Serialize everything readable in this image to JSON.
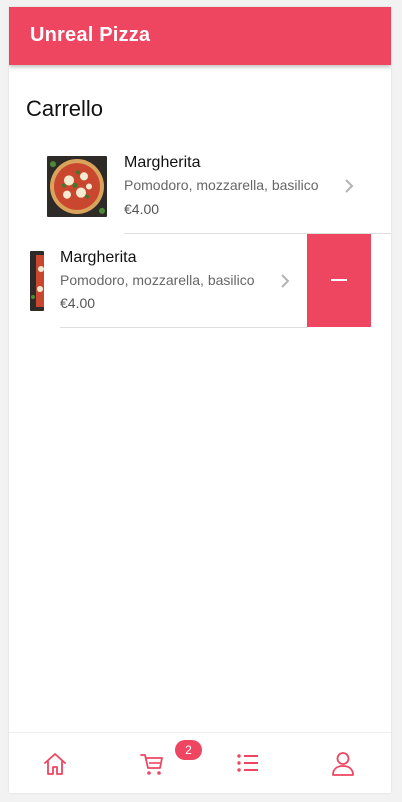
{
  "app": {
    "title": "Unreal Pizza"
  },
  "page": {
    "title": "Carrello"
  },
  "cart": {
    "items": [
      {
        "name": "Margherita",
        "description": "Pomodoro, mozzarella, basilico",
        "price": "€4.00",
        "image": "pizza-image"
      },
      {
        "name": "Margherita",
        "description": "Pomodoro, mozzarella, basilico",
        "price": "€4.00",
        "image": "pizza-image",
        "swipe_action": "remove"
      }
    ]
  },
  "tabbar": {
    "tabs": [
      {
        "name": "home",
        "icon": "home-icon"
      },
      {
        "name": "cart",
        "icon": "cart-icon",
        "badge": "2"
      },
      {
        "name": "list",
        "icon": "list-icon"
      },
      {
        "name": "account",
        "icon": "user-icon"
      }
    ]
  },
  "colors": {
    "accent": "#ee4560",
    "background": "#ffffff",
    "text": "#111111",
    "muted": "#666666"
  }
}
